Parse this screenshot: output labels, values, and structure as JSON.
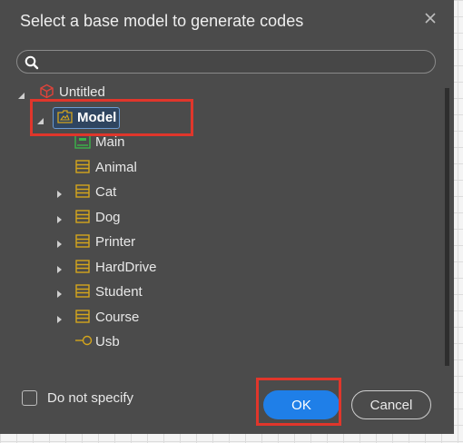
{
  "dialog": {
    "title": "Select a base model to generate codes",
    "close_icon": "close-icon"
  },
  "search": {
    "value": "",
    "placeholder": ""
  },
  "tree": {
    "root": {
      "label": "Untitled",
      "icon": "project-cube-icon",
      "color": "#e0433a"
    },
    "model": {
      "label": "Model",
      "icon": "model-package-icon"
    },
    "items": [
      {
        "label": "Main",
        "icon": "diagram-icon",
        "expandable": false
      },
      {
        "label": "Animal",
        "icon": "class-icon",
        "expandable": false
      },
      {
        "label": "Cat",
        "icon": "class-icon",
        "expandable": true
      },
      {
        "label": "Dog",
        "icon": "class-icon",
        "expandable": true
      },
      {
        "label": "Printer",
        "icon": "class-icon",
        "expandable": true
      },
      {
        "label": "HardDrive",
        "icon": "class-icon",
        "expandable": true
      },
      {
        "label": "Student",
        "icon": "class-icon",
        "expandable": true
      },
      {
        "label": "Course",
        "icon": "class-icon",
        "expandable": true
      },
      {
        "label": "Usb",
        "icon": "interface-icon",
        "expandable": false
      }
    ]
  },
  "footer": {
    "checkbox_label": "Do not specify",
    "checked": false,
    "ok_label": "OK",
    "cancel_label": "Cancel"
  },
  "colors": {
    "dialog_bg": "#4b4b4b",
    "accent": "#1f7fe8",
    "highlight": "#e0362b",
    "class_icon": "#d4a51c",
    "diagram_icon": "#3bb54a"
  }
}
